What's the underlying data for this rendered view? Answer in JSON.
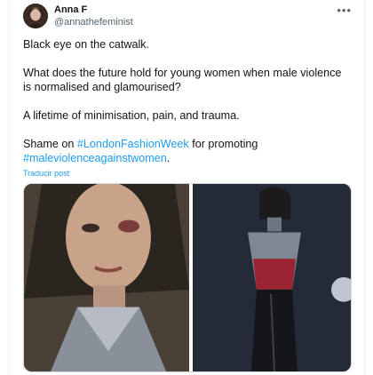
{
  "author": {
    "name": "Anna F",
    "handle": "@annathefeminist"
  },
  "icons": {
    "more": "more-horizontal-icon"
  },
  "tweet": {
    "line1": "Black eye on the catwalk.",
    "line2": "What does the future hold for young women when male violence is normalised and glamourised?",
    "line3": "A lifetime of minimisation, pain, and trauma.",
    "line4_prefix": "Shame on ",
    "hashtag1": "#LondonFashionWeek",
    "line4_mid": " for promoting",
    "hashtag2": "#maleviolenceagainstwomen",
    "line4_suffix": "."
  },
  "translate_label": "Traducir post",
  "colors": {
    "link": "#1d9bf0",
    "secondary_text": "#536471"
  }
}
